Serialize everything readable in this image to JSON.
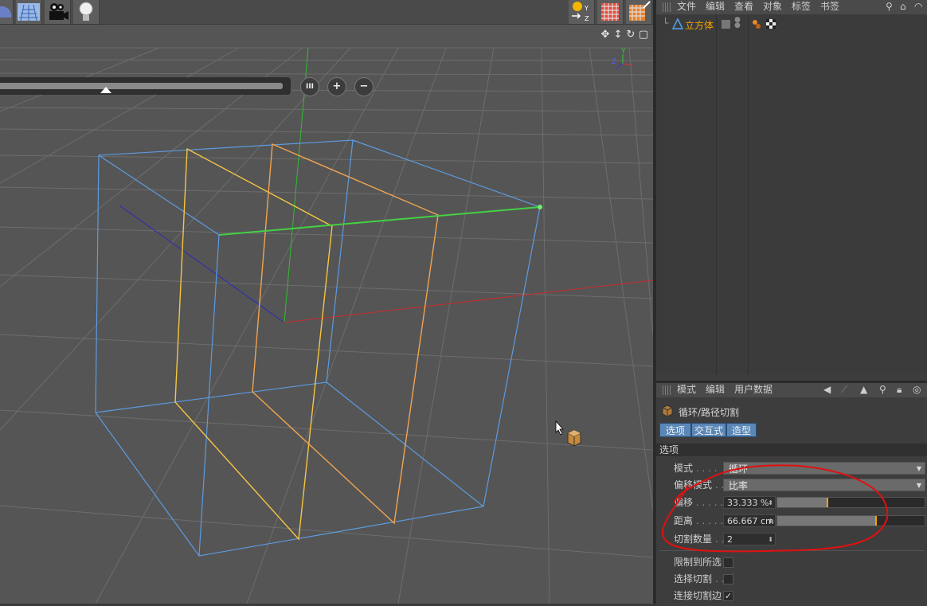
{
  "viewport": {
    "toolbar_icons": [
      "layers-icon",
      "floor-grid-icon",
      "camera-icon",
      "light-bulb-icon",
      "axis-xyz-icon",
      "render-region-icon",
      "render-settings-icon"
    ],
    "axis_labels": {
      "y": "Y",
      "z": "Z"
    },
    "slider_buttons": {
      "pause": "III",
      "plus": "+",
      "minus": "−"
    }
  },
  "object_manager": {
    "menu": [
      "文件",
      "编辑",
      "查看",
      "对象",
      "标签",
      "书签"
    ],
    "object": {
      "name": "立方体"
    }
  },
  "attribute_manager": {
    "menu": [
      "模式",
      "编辑",
      "用户数据"
    ],
    "tool_name": "循环/路径切割",
    "tabs": [
      "选项",
      "交互式",
      "造型"
    ],
    "section": "选项",
    "properties": {
      "mode": {
        "label": "模式",
        "dots": ". . . .",
        "value": "循环"
      },
      "offset_mode": {
        "label": "偏移模式",
        "dots": ". .",
        "value": "比率"
      },
      "offset": {
        "label": "偏移",
        "dots": ". . . . .",
        "value": "33.333 %",
        "fraction": 0.33333
      },
      "distance": {
        "label": "距离",
        "dots": ". . . . .",
        "value": "66.667 cm",
        "fraction": 0.66667
      },
      "cut_count": {
        "label": "切割数量",
        "dots": ". .",
        "value": "2"
      },
      "restrict_selection": {
        "label": "限制到所选",
        "dots": "",
        "checked": false
      },
      "select_cuts": {
        "label": "选择切割",
        "dots": ". .",
        "checked": false
      },
      "connect_edges": {
        "label": "连接切割边",
        "dots": "",
        "checked": true
      }
    }
  },
  "colors": {
    "cube_edge": "#5c9be0",
    "cut_line_1": "#f5c542",
    "cut_line_2": "#f0a450",
    "selected_edge": "#44d044",
    "annotation": "#e01010",
    "accent": "#f4a300",
    "tab_active": "#5a87b8"
  }
}
